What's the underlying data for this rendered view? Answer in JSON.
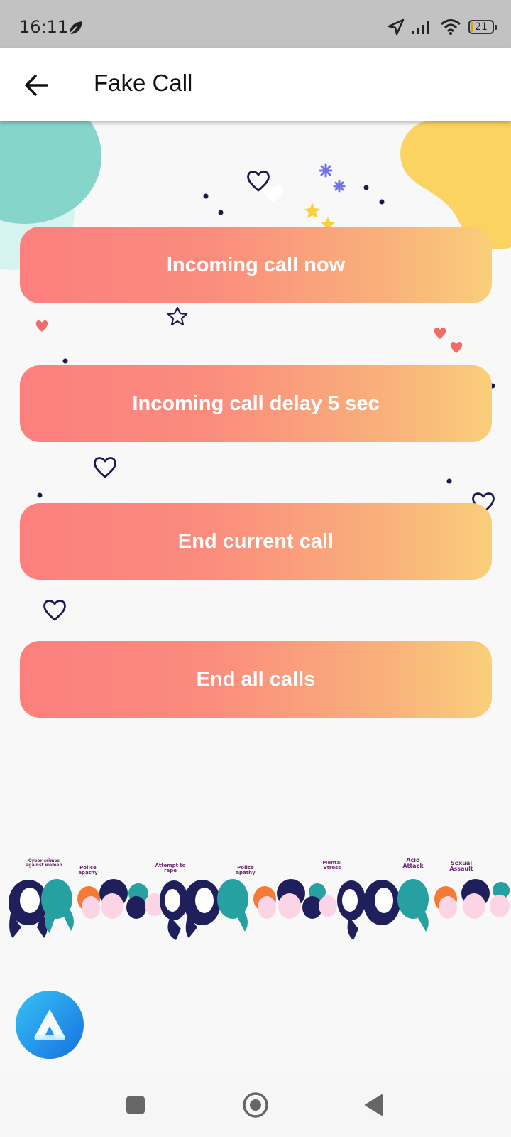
{
  "status_bar": {
    "time": "16:11",
    "battery_level": "21",
    "icons": [
      "leaf-icon",
      "location-arrow-icon",
      "signal-icon",
      "wifi-icon",
      "battery-icon"
    ]
  },
  "app_bar": {
    "title": "Fake Call",
    "back_icon": "arrow-left-icon"
  },
  "actions": {
    "incoming_now": "Incoming call now",
    "incoming_delay": "Incoming call delay 5 sec",
    "end_current": "End current call",
    "end_all": "End all calls"
  },
  "banner_labels": {
    "l1": "Cyber crimes against women",
    "l2": "Police apathy",
    "l3": "Attempt to rape",
    "l4": "Police apathy",
    "l5": "Mental Stress",
    "l6": "Acid Attack",
    "l7": "Sexual Assault"
  },
  "colors": {
    "button_gradient_start": "#fc7f7e",
    "button_gradient_end": "#f9cf79",
    "teal_blob": "#86d5cb",
    "yellow_blob": "#fbd361",
    "fab": "#2196f3"
  },
  "nav_bar": {
    "icons": [
      "recent-apps-icon",
      "home-icon",
      "back-triangle-icon"
    ]
  }
}
